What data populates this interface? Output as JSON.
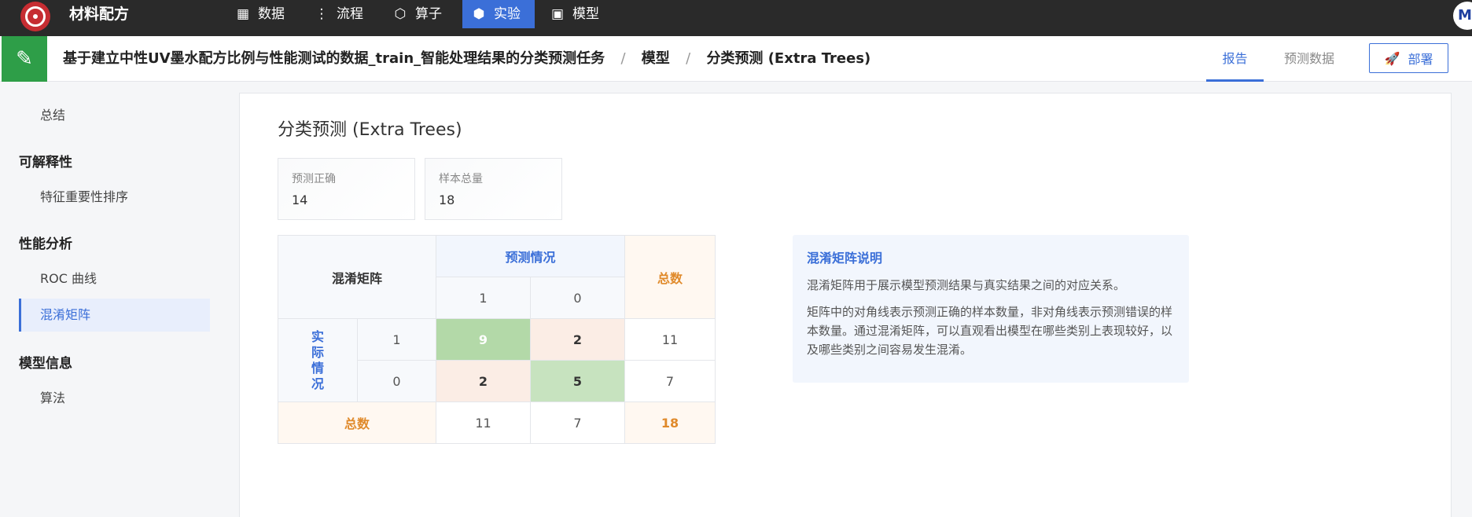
{
  "app": {
    "title": "材料配方"
  },
  "nav": [
    {
      "label": "数据",
      "icon": "table-icon"
    },
    {
      "label": "流程",
      "icon": "flow-icon"
    },
    {
      "label": "算子",
      "icon": "operator-icon"
    },
    {
      "label": "实验",
      "icon": "cube-icon",
      "active": true
    },
    {
      "label": "模型",
      "icon": "save-icon"
    }
  ],
  "avatar": {
    "initial": "M"
  },
  "header": {
    "breadcrumb": [
      "基于建立中性UV墨水配方比例与性能测试的数据_train_智能处理结果的分类预测任务",
      "模型",
      "分类预测 (Extra Trees)"
    ],
    "separator": "/",
    "tabs": [
      {
        "label": "报告",
        "active": true
      },
      {
        "label": "预测数据",
        "active": false
      }
    ],
    "deploy_label": "部署"
  },
  "sidebar": {
    "summary": "总结",
    "sections": [
      {
        "title": "可解释性",
        "items": [
          "特征重要性排序"
        ]
      },
      {
        "title": "性能分析",
        "items": [
          "ROC 曲线",
          "混淆矩阵"
        ]
      },
      {
        "title": "模型信息",
        "items": [
          "算法"
        ]
      }
    ],
    "active_item": "混淆矩阵"
  },
  "main": {
    "title": "分类预测 (Extra Trees)",
    "stats": [
      {
        "label": "预测正确",
        "value": "14"
      },
      {
        "label": "样本总量",
        "value": "18"
      }
    ]
  },
  "confusion_matrix": {
    "corner_label": "混淆矩阵",
    "predicted_label": "预测情况",
    "actual_label": "实际情况",
    "total_label": "总数",
    "classes": [
      "1",
      "0"
    ],
    "matrix": [
      [
        9,
        2
      ],
      [
        2,
        5
      ]
    ],
    "row_totals": [
      11,
      7
    ],
    "col_totals": [
      11,
      7
    ],
    "grand_total": 18
  },
  "explanation": {
    "title": "混淆矩阵说明",
    "paragraphs": [
      "混淆矩阵用于展示模型预测结果与真实结果之间的对应关系。",
      "矩阵中的对角线表示预测正确的样本数量，非对角线表示预测错误的样本数量。通过混淆矩阵，可以直观看出模型在哪些类别上表现较好，以及哪些类别之间容易发生混淆。"
    ]
  }
}
